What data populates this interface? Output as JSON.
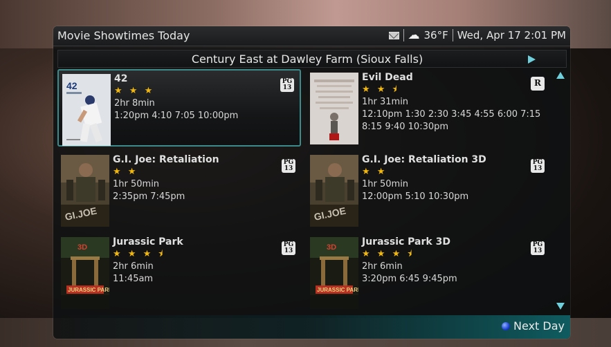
{
  "header": {
    "title": "Movie Showtimes Today",
    "temperature": "36°F",
    "datetime": "Wed, Apr 17 2:01 PM"
  },
  "theater": {
    "name": "Century East at Dawley Farm (Sioux Falls)"
  },
  "movies": [
    {
      "title": "42",
      "stars": "★ ★ ★",
      "rating_top": "PG",
      "rating_bottom": "13",
      "runtime": "2hr 8min",
      "times": "1:20pm 4:10 7:05 10:00pm",
      "selected": true
    },
    {
      "title": "Evil Dead",
      "stars": "★ ★ ⯨",
      "rating_top": "R",
      "rating_bottom": "",
      "runtime": "1hr 31min",
      "times": "12:10pm 1:30 2:30 3:45 4:55 6:00 7:15 8:15 9:40 10:30pm"
    },
    {
      "title": "G.I. Joe: Retaliation",
      "stars": "★ ★",
      "rating_top": "PG",
      "rating_bottom": "13",
      "runtime": "1hr 50min",
      "times": "2:35pm 7:45pm"
    },
    {
      "title": "G.I. Joe: Retaliation 3D",
      "stars": "★ ★",
      "rating_top": "PG",
      "rating_bottom": "13",
      "runtime": "1hr 50min",
      "times": "12:00pm 5:10 10:30pm"
    },
    {
      "title": "Jurassic Park",
      "stars": "★ ★ ★ ⯨",
      "rating_top": "PG",
      "rating_bottom": "13",
      "runtime": "2hr 6min",
      "times": "11:45am"
    },
    {
      "title": "Jurassic Park 3D",
      "stars": "★ ★ ★ ⯨",
      "rating_top": "PG",
      "rating_bottom": "13",
      "runtime": "2hr 6min",
      "times": "3:20pm 6:45 9:45pm"
    }
  ],
  "footer": {
    "next_day_label": "Next Day"
  },
  "colors": {
    "accent": "#6fd0dc",
    "star": "#f2b80c",
    "selection_border": "#3e8b8c"
  }
}
